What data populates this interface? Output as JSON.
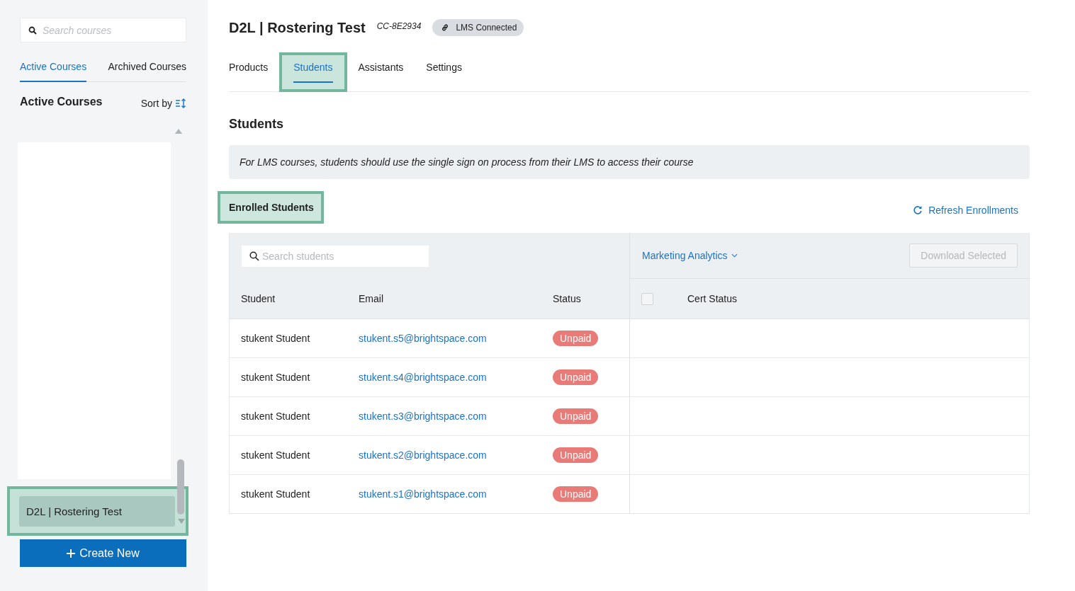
{
  "sidebar": {
    "search": {
      "placeholder": "Search courses"
    },
    "tabs": [
      {
        "label": "Active Courses",
        "selected": true
      },
      {
        "label": "Archived Courses",
        "selected": false
      }
    ],
    "heading": "Active Courses",
    "sort_label": "Sort by",
    "courses": [
      {
        "name": "D2L | Rostering Test",
        "selected": true,
        "highlighted": true
      }
    ],
    "create_button": "Create New"
  },
  "header": {
    "title": "D2L | Rostering Test",
    "code": "CC-8E2934",
    "badge": "LMS Connected"
  },
  "tabs": [
    {
      "label": "Products",
      "selected": false,
      "highlighted": false
    },
    {
      "label": "Students",
      "selected": true,
      "highlighted": true
    },
    {
      "label": "Assistants",
      "selected": false,
      "highlighted": false
    },
    {
      "label": "Settings",
      "selected": false,
      "highlighted": false
    }
  ],
  "section_title": "Students",
  "notice": "For LMS courses, students should use the single sign on process from their LMS to access their course",
  "enrolled": {
    "label": "Enrolled Students",
    "highlighted": true
  },
  "refresh_link": "Refresh Enrollments",
  "table": {
    "search": {
      "placeholder": "Search students"
    },
    "product_dropdown": "Marketing Analytics",
    "download_button": {
      "label": "Download Selected",
      "disabled": true
    },
    "columns": [
      "Student",
      "Email",
      "Status"
    ],
    "select_all": {
      "checked": false
    },
    "cert_column": "Cert Status",
    "rows": [
      {
        "student": "stukent Student",
        "email": "stukent.s5@brightspace.com",
        "status": "Unpaid"
      },
      {
        "student": "stukent Student",
        "email": "stukent.s4@brightspace.com",
        "status": "Unpaid"
      },
      {
        "student": "stukent Student",
        "email": "stukent.s3@brightspace.com",
        "status": "Unpaid"
      },
      {
        "student": "stukent Student",
        "email": "stukent.s2@brightspace.com",
        "status": "Unpaid"
      },
      {
        "student": "stukent Student",
        "email": "stukent.s1@brightspace.com",
        "status": "Unpaid"
      }
    ]
  }
}
